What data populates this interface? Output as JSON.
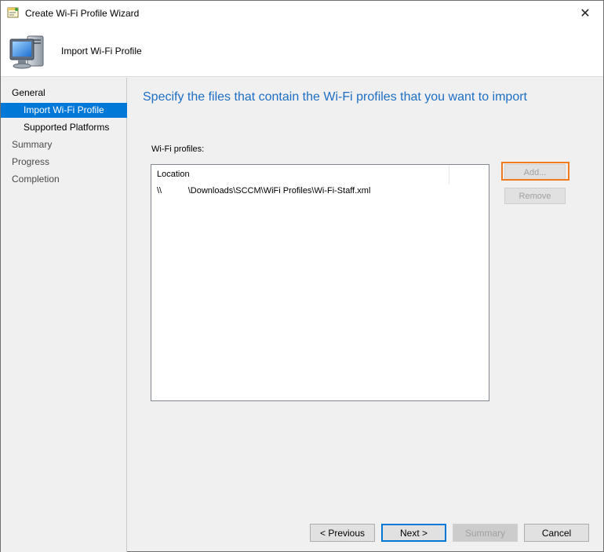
{
  "window": {
    "title": "Create Wi-Fi Profile Wizard",
    "close_glyph": "✕"
  },
  "header": {
    "title": "Import Wi-Fi Profile",
    "icon": "computer-icon"
  },
  "sidebar": {
    "items": [
      {
        "label": "General",
        "level": 1,
        "state": "normal"
      },
      {
        "label": "Import Wi-Fi Profile",
        "level": 2,
        "state": "active"
      },
      {
        "label": "Supported Platforms",
        "level": 2,
        "state": "normal"
      },
      {
        "label": "Summary",
        "level": 1,
        "state": "disabled"
      },
      {
        "label": "Progress",
        "level": 1,
        "state": "disabled"
      },
      {
        "label": "Completion",
        "level": 1,
        "state": "disabled"
      }
    ]
  },
  "main": {
    "heading": "Specify the files that contain the Wi-Fi profiles that you want to import",
    "list_label": "Wi-Fi profiles:",
    "columns": [
      "Location"
    ],
    "rows": [
      {
        "location": "\\\\           \\Downloads\\SCCM\\WiFi Profiles\\Wi-Fi-Staff.xml"
      }
    ],
    "add_label": "Add...",
    "remove_label": "Remove"
  },
  "footer": {
    "previous_label": "< Previous",
    "next_label": "Next >",
    "summary_label": "Summary",
    "cancel_label": "Cancel"
  },
  "colors": {
    "accent": "#0078d7",
    "heading": "#1e6fc4",
    "highlight": "#f07b1e"
  }
}
